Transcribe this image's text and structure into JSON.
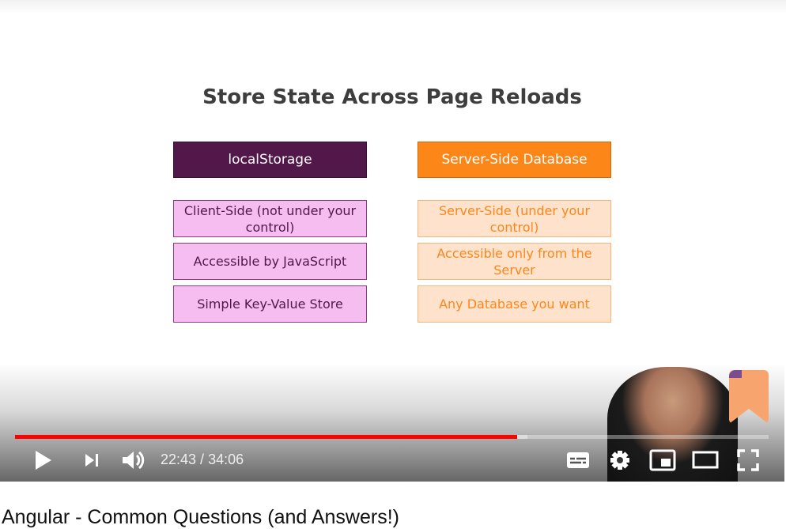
{
  "slide": {
    "title": "Store State Across Page Reloads",
    "left": {
      "header": "localStorage",
      "items": [
        "Client-Side (not under your control)",
        "Accessible by JavaScript",
        "Simple Key-Value Store"
      ]
    },
    "right": {
      "header": "Server-Side Database",
      "items": [
        "Server-Side (under your control)",
        "Accessible only from the Server",
        "Any Database you want"
      ]
    }
  },
  "player": {
    "current_time": "22:43",
    "duration": "34:06",
    "time_sep": " / ",
    "progress_percent": 66.6,
    "icons": [
      "play-icon",
      "next-icon",
      "volume-icon",
      "subtitles-icon",
      "settings-icon",
      "miniplayer-icon",
      "theater-icon",
      "fullscreen-icon"
    ]
  },
  "video_title": "Angular - Common Questions (and Answers!)",
  "colors": {
    "progress": "#ff0000",
    "localstorage": "#52184a",
    "server": "#fd8619"
  }
}
